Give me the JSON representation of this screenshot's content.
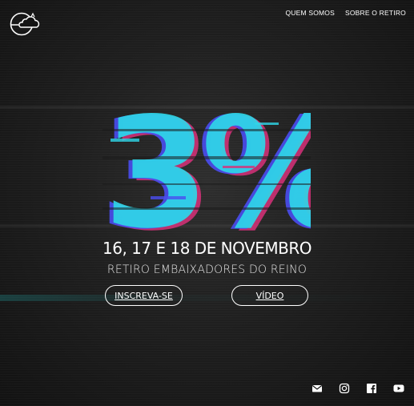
{
  "header": {
    "logo": "logo-cloud-icon",
    "nav": [
      {
        "label": "QUEM SOMOS"
      },
      {
        "label": "SOBRE O RETIRO"
      }
    ]
  },
  "hero": {
    "headline": "3%",
    "date": "16, 17 E 18 DE NOVEMBRO",
    "subtitle": "RETIRO EMBAIXADORES DO REINO",
    "register_label": "INSCREVA-SE",
    "video_label": "VÍDEO"
  },
  "social": [
    {
      "icon": "mail-icon"
    },
    {
      "icon": "instagram-icon"
    },
    {
      "icon": "facebook-icon"
    },
    {
      "icon": "youtube-icon"
    }
  ],
  "colors": {
    "background": "#1a1a1a",
    "glitch_cyan": "#2fd6e8",
    "glitch_magenta": "#d8317a",
    "glitch_blue": "#4a4df0",
    "text": "#ffffff"
  }
}
